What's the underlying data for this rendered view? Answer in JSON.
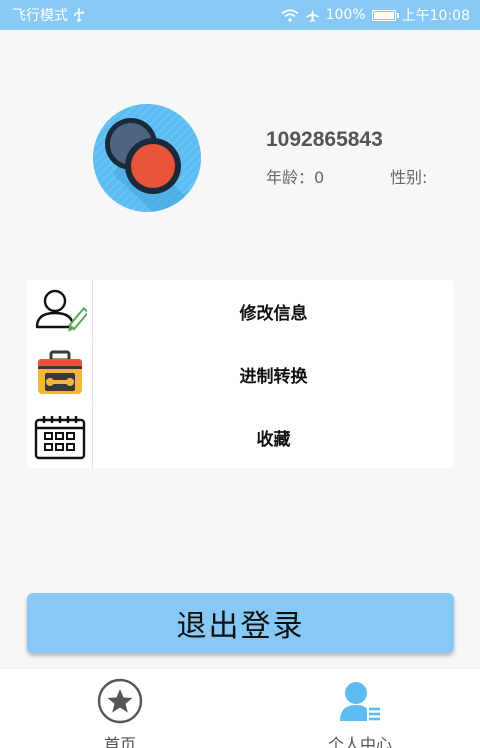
{
  "status_bar": {
    "mode": "飞行模式",
    "battery": "100%",
    "battery_level": 1.0,
    "time": "上午10:08"
  },
  "profile": {
    "user_id": "1092865843",
    "age_label": "年龄：",
    "age_value": "0",
    "gender_label": "性别:",
    "gender_value": ""
  },
  "menu": {
    "items": [
      {
        "label": "修改信息",
        "icon": "user-edit-icon"
      },
      {
        "label": "进制转换",
        "icon": "toolbox-icon"
      },
      {
        "label": "收藏",
        "icon": "calendar-icon"
      }
    ]
  },
  "logout": {
    "label": "退出登录"
  },
  "bottom_nav": {
    "items": [
      {
        "label": "首页",
        "icon": "star-icon"
      },
      {
        "label": "个人中心",
        "icon": "person-icon"
      }
    ]
  },
  "colors": {
    "accent": "#87c9f4",
    "background": "#f7f7f7"
  }
}
